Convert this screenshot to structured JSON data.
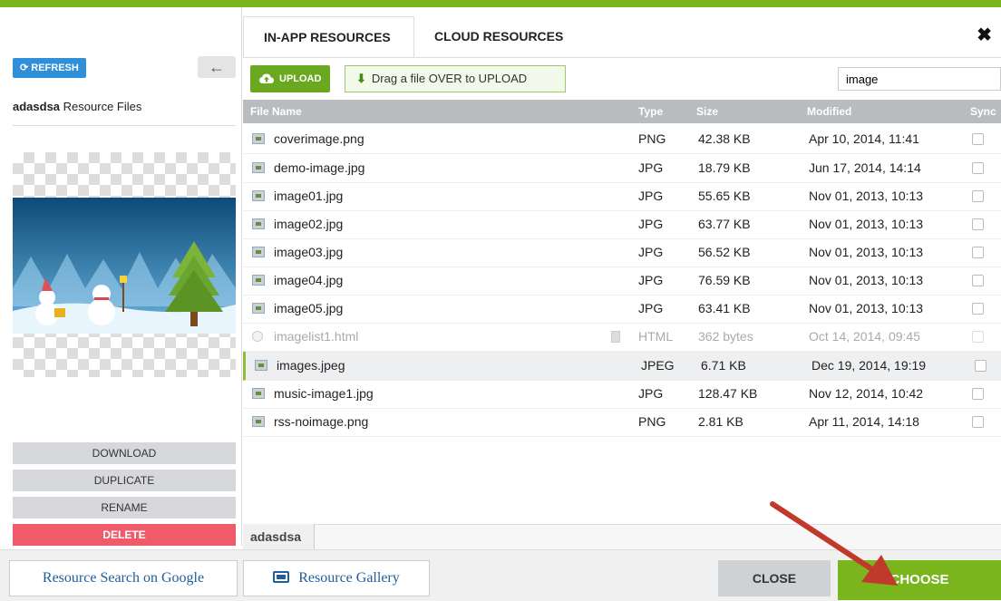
{
  "tabs": [
    "IN-APP RESOURCES",
    "CLOUD RESOURCES"
  ],
  "close_symbol": "✖",
  "sidebar": {
    "refresh_label": "REFRESH",
    "back_symbol": "←",
    "project_name": "adasdsa",
    "resource_files_label": "Resource Files",
    "actions": {
      "download": "DOWNLOAD",
      "duplicate": "DUPLICATE",
      "rename": "RENAME",
      "delete": "DELETE"
    }
  },
  "toolbar": {
    "upload_label": "UPLOAD",
    "drag_label": "Drag a file OVER to UPLOAD",
    "search_value": "image"
  },
  "table": {
    "columns": [
      "File Name",
      "Type",
      "Size",
      "Modified",
      "Sync"
    ],
    "rows": [
      {
        "name": "coverimage.png",
        "type": "PNG",
        "size": "42.38 KB",
        "modified": "Apr 10, 2014, 11:41"
      },
      {
        "name": "demo-image.jpg",
        "type": "JPG",
        "size": "18.79 KB",
        "modified": "Jun 17, 2014, 14:14"
      },
      {
        "name": "image01.jpg",
        "type": "JPG",
        "size": "55.65 KB",
        "modified": "Nov 01, 2013, 10:13"
      },
      {
        "name": "image02.jpg",
        "type": "JPG",
        "size": "63.77 KB",
        "modified": "Nov 01, 2013, 10:13"
      },
      {
        "name": "image03.jpg",
        "type": "JPG",
        "size": "56.52 KB",
        "modified": "Nov 01, 2013, 10:13"
      },
      {
        "name": "image04.jpg",
        "type": "JPG",
        "size": "76.59 KB",
        "modified": "Nov 01, 2013, 10:13"
      },
      {
        "name": "image05.jpg",
        "type": "JPG",
        "size": "63.41 KB",
        "modified": "Nov 01, 2013, 10:13"
      },
      {
        "name": "imagelist1.html",
        "type": "HTML",
        "size": "362 bytes",
        "modified": "Oct 14, 2014, 09:45"
      },
      {
        "name": "images.jpeg",
        "type": "JPEG",
        "size": "6.71 KB",
        "modified": "Dec 19, 2014, 19:19"
      },
      {
        "name": "music-image1.jpg",
        "type": "JPG",
        "size": "128.47 KB",
        "modified": "Nov 12, 2014, 10:42"
      },
      {
        "name": "rss-noimage.png",
        "type": "PNG",
        "size": "2.81 KB",
        "modified": "Apr 11, 2014, 14:18"
      }
    ]
  },
  "breadcrumb": "adasdsa",
  "footer": {
    "google_search": "Resource Search on Google",
    "gallery": "Resource Gallery",
    "close": "CLOSE",
    "choose": "CHOOSE"
  },
  "colors": {
    "accent": "#7ab51d",
    "refresh": "#2f8fd8",
    "delete": "#ef5b6b",
    "annotation_arrow": "#c0392b"
  }
}
